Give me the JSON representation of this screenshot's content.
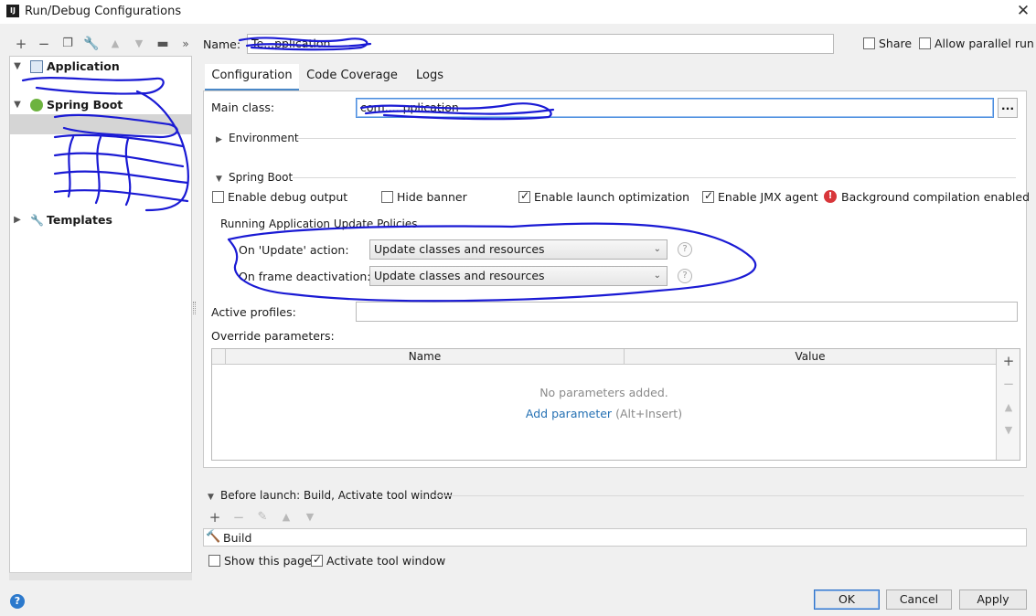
{
  "window": {
    "title": "Run/Debug Configurations",
    "app_icon": "IJ"
  },
  "toolbar": {
    "icons": [
      "add-icon",
      "remove-icon",
      "copy-icon",
      "wrench-icon",
      "move-up-icon",
      "move-down-icon",
      "folder-icon",
      "more-icon"
    ]
  },
  "tree": {
    "items": [
      {
        "label": "Application",
        "icon": "application-icon"
      },
      {
        "label": "Spring Boot",
        "icon": "spring-boot-icon"
      },
      {
        "label": "Templates",
        "icon": "wrench-icon"
      }
    ]
  },
  "name_field": {
    "label": "Name:",
    "value": "Te...pplication"
  },
  "share": {
    "label": "Share",
    "checked": false
  },
  "parallel": {
    "label": "Allow parallel run",
    "checked": false
  },
  "tabs": [
    {
      "label": "Configuration",
      "active": true
    },
    {
      "label": "Code Coverage",
      "active": false
    },
    {
      "label": "Logs",
      "active": false
    }
  ],
  "main_class": {
    "label": "Main class:",
    "value": "com.....pplication",
    "browse_label": "..."
  },
  "environment": {
    "label": "Environment"
  },
  "spring_boot": {
    "label": "Spring Boot",
    "options": [
      {
        "label": "Enable debug output",
        "checked": false
      },
      {
        "label": "Hide banner",
        "checked": false
      },
      {
        "label": "Enable launch optimization",
        "checked": true
      },
      {
        "label": "Enable JMX agent",
        "checked": true
      }
    ],
    "warning": "Background compilation enabled"
  },
  "update_policies": {
    "title": "Running Application Update Policies",
    "on_update": {
      "label": "On 'Update' action:",
      "value": "Update classes and resources"
    },
    "on_frame": {
      "label": "On frame deactivation:",
      "value": "Update classes and resources"
    },
    "help": "?"
  },
  "active_profiles": {
    "label": "Active profiles:",
    "value": ""
  },
  "override": {
    "label": "Override parameters:",
    "columns": [
      "Name",
      "Value"
    ],
    "empty_text": "No parameters added.",
    "add_link": "Add parameter",
    "shortcut": "(Alt+Insert)"
  },
  "before_launch": {
    "label": "Before launch: Build, Activate tool window",
    "items": [
      {
        "label": "Build",
        "icon": "hammer-icon"
      }
    ]
  },
  "show_page": {
    "label": "Show this page",
    "checked": false
  },
  "activate_tool": {
    "label": "Activate tool window",
    "checked": true
  },
  "buttons": {
    "ok": "OK",
    "cancel": "Cancel",
    "apply": "Apply"
  },
  "colors": {
    "accent": "#4a88c7",
    "link": "#2470b3",
    "error": "#d8363a",
    "scribble": "#1a1ad4"
  }
}
